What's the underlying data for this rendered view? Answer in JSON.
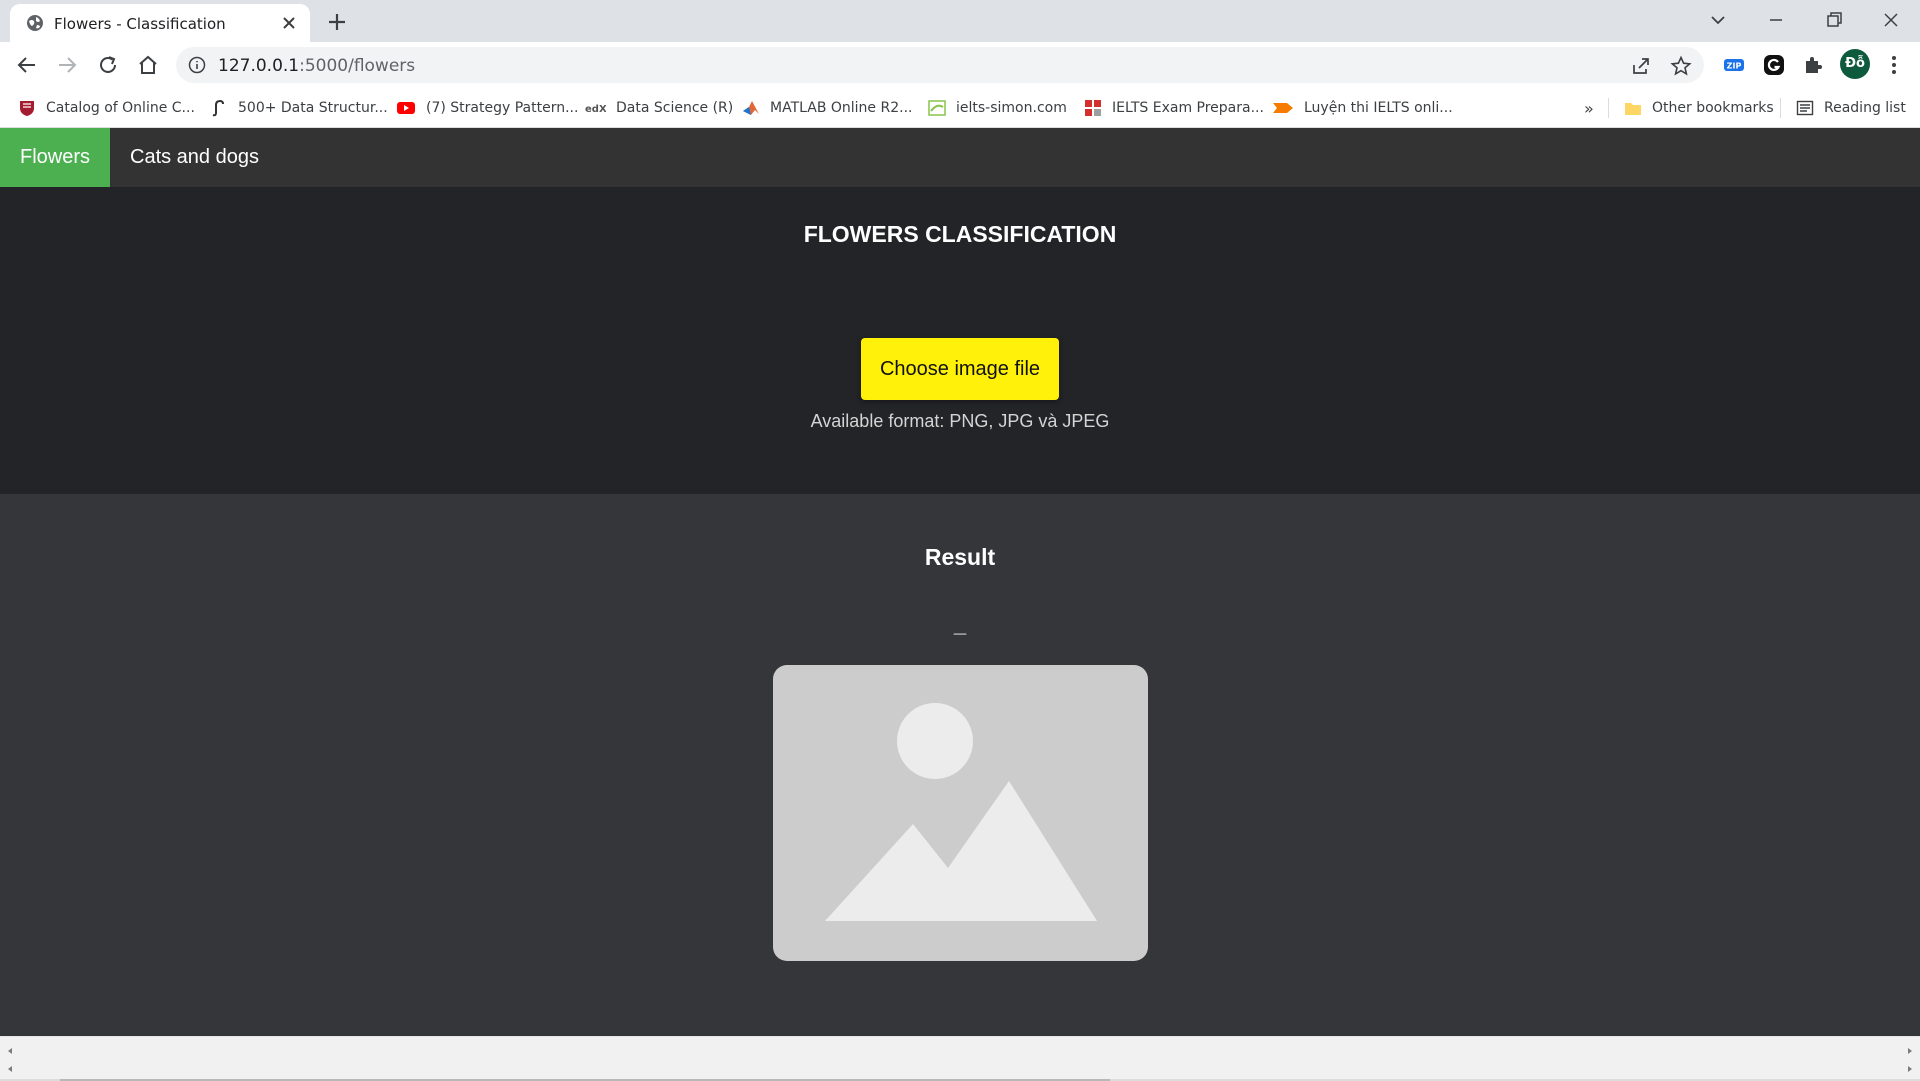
{
  "browser": {
    "tab_title": "Flowers - Classification",
    "url_host": "127.0.0.1",
    "url_path": ":5000/flowers",
    "avatar_initials": "Đỗ",
    "bookmarks": [
      {
        "label": "Catalog of Online C...",
        "icon": "harvard-shield-icon",
        "color": "#a51c30"
      },
      {
        "label": "500+ Data Structur...",
        "icon": "gfg-icon",
        "color": "#333333"
      },
      {
        "label": "(7) Strategy Pattern...",
        "icon": "youtube-icon",
        "color": "#ff0000"
      },
      {
        "label": "Data Science (R)",
        "icon": "edx-icon",
        "color": "#555555"
      },
      {
        "label": "MATLAB Online R2...",
        "icon": "matlab-icon",
        "color": "#e16737"
      },
      {
        "label": "ielts-simon.com",
        "icon": "ielts-simon-icon",
        "color": "#8bc34a"
      },
      {
        "label": "IELTS Exam Prepara...",
        "icon": "ielts-exam-icon",
        "color": "#d32f2f"
      },
      {
        "label": "Luyện thi IELTS onli...",
        "icon": "ielts-online-icon",
        "color": "#f57c00"
      }
    ],
    "overflow_label": "»",
    "other_bookmarks": "Other bookmarks",
    "reading_list": "Reading list"
  },
  "nav": {
    "items": [
      {
        "label": "Flowers",
        "active": true
      },
      {
        "label": "Cats and dogs",
        "active": false
      }
    ]
  },
  "upload": {
    "title": "FLOWERS CLASSIFICATION",
    "button_label": "Choose image file",
    "format_note": "Available format: PNG, JPG và JPEG"
  },
  "result": {
    "title": "Result",
    "label": "_",
    "image_icon": "image-placeholder-icon"
  },
  "colors": {
    "accent_green": "#4caf50",
    "button_yellow": "#fff10a",
    "upload_bg": "#232427",
    "result_bg": "#35363a",
    "nav_bg": "#333333",
    "placeholder_bg": "#cccccc"
  }
}
